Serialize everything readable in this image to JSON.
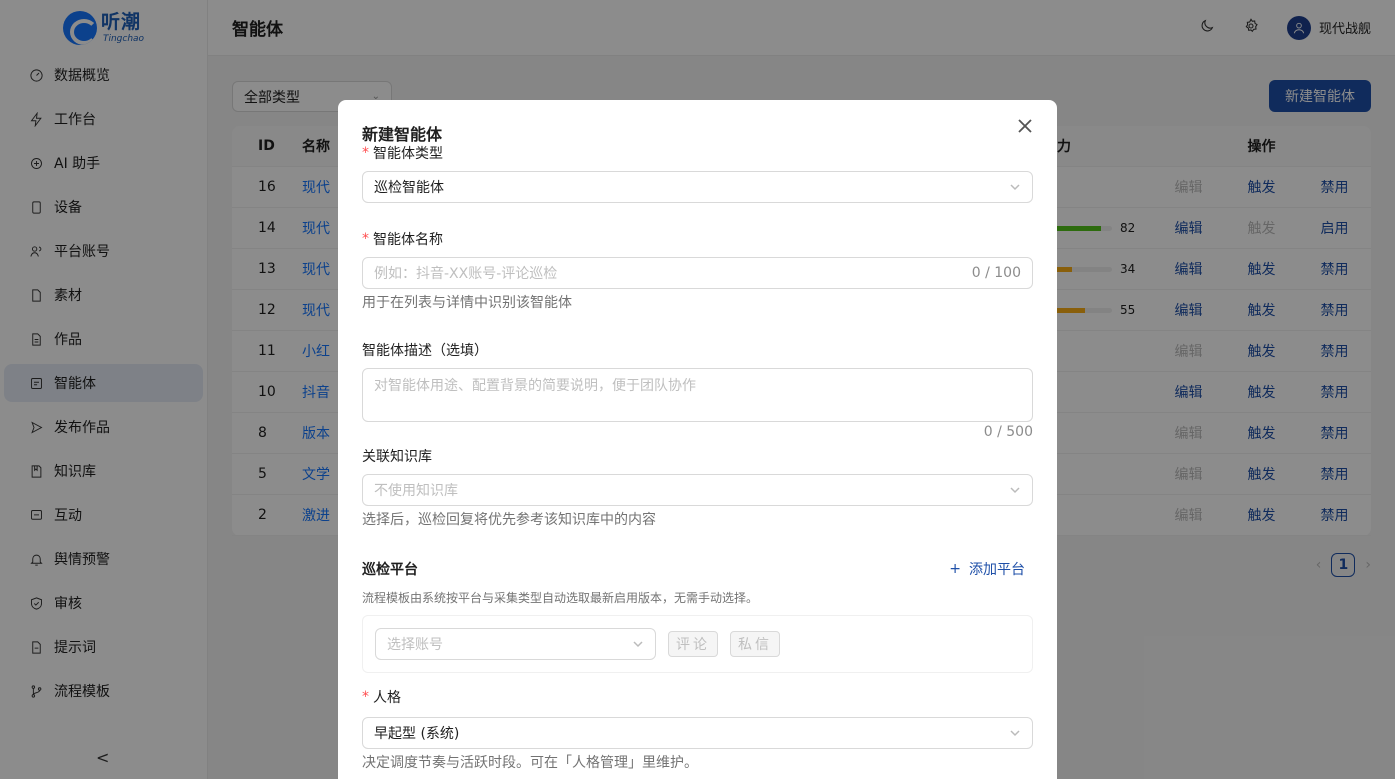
{
  "brand": {
    "name_cn": "听潮",
    "name_en": "Tingchao"
  },
  "sidebar": {
    "items": [
      {
        "label": "数据概览",
        "icon": "dashboard-icon"
      },
      {
        "label": "工作台",
        "icon": "bolt-icon"
      },
      {
        "label": "AI 助手",
        "icon": "ai-icon"
      },
      {
        "label": "设备",
        "icon": "device-icon"
      },
      {
        "label": "平台账号",
        "icon": "users-icon"
      },
      {
        "label": "素材",
        "icon": "file-icon"
      },
      {
        "label": "作品",
        "icon": "document-icon"
      },
      {
        "label": "智能体",
        "icon": "agent-icon"
      },
      {
        "label": "发布作品",
        "icon": "send-icon"
      },
      {
        "label": "知识库",
        "icon": "book-icon"
      },
      {
        "label": "互动",
        "icon": "chat-icon"
      },
      {
        "label": "舆情预警",
        "icon": "alert-icon"
      },
      {
        "label": "审核",
        "icon": "shield-check-icon"
      },
      {
        "label": "提示词",
        "icon": "prompt-icon"
      },
      {
        "label": "流程模板",
        "icon": "flow-icon"
      }
    ],
    "active_index": 7,
    "collapse_label": "<"
  },
  "header": {
    "title": "智能体",
    "user_name": "现代战舰"
  },
  "main": {
    "type_filter": "全部类型",
    "new_button": "新建智能体",
    "columns": {
      "id": "ID",
      "name": "名称",
      "ability": "力",
      "ops": "操作"
    },
    "rows": [
      {
        "id": "16",
        "name": "现代",
        "ops": [
          "编辑",
          "触发",
          "禁用"
        ],
        "ops_enabled": [
          false,
          true,
          true
        ]
      },
      {
        "id": "14",
        "name": "现代",
        "score": "82",
        "ops": [
          "编辑",
          "触发",
          "启用"
        ],
        "ops_enabled": [
          true,
          false,
          true
        ]
      },
      {
        "id": "13",
        "name": "现代",
        "score": "34",
        "ops": [
          "编辑",
          "触发",
          "禁用"
        ],
        "ops_enabled": [
          true,
          true,
          true
        ]
      },
      {
        "id": "12",
        "name": "现代",
        "score": "55",
        "ops": [
          "编辑",
          "触发",
          "禁用"
        ],
        "ops_enabled": [
          true,
          true,
          true
        ]
      },
      {
        "id": "11",
        "name": "小红",
        "ops": [
          "编辑",
          "触发",
          "禁用"
        ],
        "ops_enabled": [
          false,
          true,
          true
        ]
      },
      {
        "id": "10",
        "name": "抖音",
        "ops": [
          "编辑",
          "触发",
          "禁用"
        ],
        "ops_enabled": [
          true,
          true,
          true
        ]
      },
      {
        "id": "8",
        "name": "版本",
        "ops": [
          "编辑",
          "触发",
          "禁用"
        ],
        "ops_enabled": [
          false,
          true,
          true
        ]
      },
      {
        "id": "5",
        "name": "文学",
        "ops": [
          "编辑",
          "触发",
          "禁用"
        ],
        "ops_enabled": [
          false,
          true,
          true
        ]
      },
      {
        "id": "2",
        "name": "激进",
        "ops": [
          "编辑",
          "触发",
          "禁用"
        ],
        "ops_enabled": [
          false,
          true,
          true
        ]
      }
    ],
    "scores": [
      {
        "value": 0.82,
        "color": "#52c41a"
      },
      {
        "value": 0.34,
        "color": "#faad14"
      },
      {
        "value": 0.55,
        "color": "#faad14"
      }
    ],
    "page": "1"
  },
  "modal": {
    "title": "新建智能体",
    "type_label": "智能体类型",
    "type_value": "巡检智能体",
    "name_label": "智能体名称",
    "name_placeholder": "例如：抖音-XX账号-评论巡检",
    "name_count": "0 / 100",
    "name_help": "用于在列表与详情中识别该智能体",
    "desc_label": "智能体描述（选填）",
    "desc_placeholder": "对智能体用途、配置背景的简要说明，便于团队协作",
    "desc_count": "0 / 500",
    "kb_label": "关联知识库",
    "kb_placeholder": "不使用知识库",
    "kb_help": "选择后，巡检回复将优先参考该知识库中的内容",
    "platform_label": "巡检平台",
    "add_platform": "添加平台",
    "platform_help": "流程模板由系统按平台与采集类型自动选取最新启用版本，无需手动选择。",
    "account_placeholder": "选择账号",
    "tag_comment": "评论",
    "tag_dm": "私信",
    "persona_label": "人格",
    "persona_value": "早起型 (系统)",
    "persona_help": "决定调度节奏与活跃时段。可在「人格管理」里维护。"
  }
}
